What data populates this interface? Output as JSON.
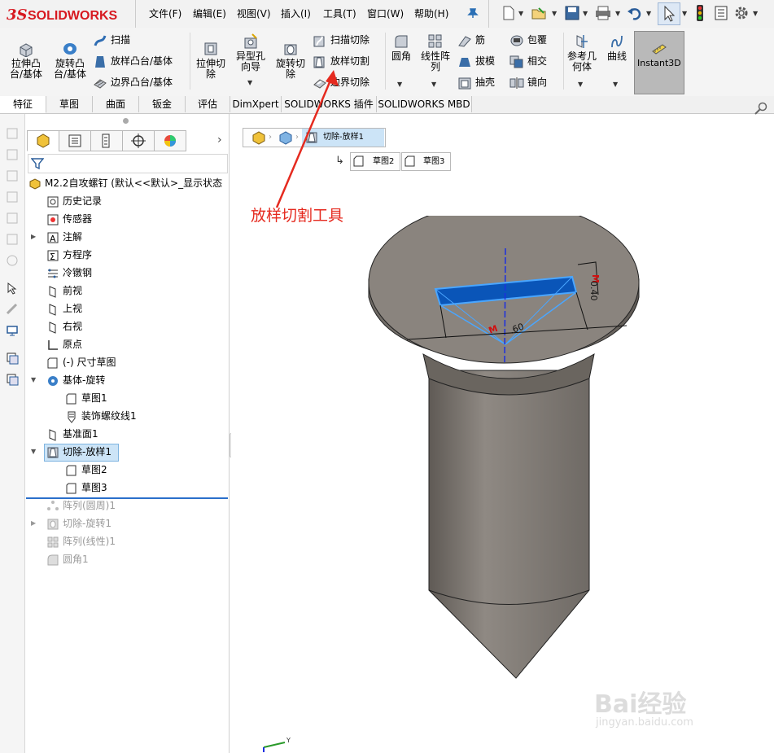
{
  "app": {
    "brand": "SOLIDWORKS",
    "brand_color": "#d71920"
  },
  "menu": [
    "文件(F)",
    "编辑(E)",
    "视图(V)",
    "插入(I)",
    "工具(T)",
    "窗口(W)",
    "帮助(H)"
  ],
  "ribbon": {
    "extrude_boss": "拉伸凸\n台/基体",
    "revolve_boss": "旋转凸\n台/基体",
    "sweep": "扫描",
    "loft_boss": "放样凸台/基体",
    "boundary_boss": "边界凸台/基体",
    "extrude_cut": "拉伸切\n除",
    "hole_wizard": "异型孔\n向导",
    "revolve_cut": "旋转切\n除",
    "sweep_cut": "扫描切除",
    "loft_cut": "放样切割",
    "boundary_cut": "边界切除",
    "fillet": "圆角",
    "linear_pattern": "线性阵\n列",
    "rib": "筋",
    "draft": "拔模",
    "shell": "抽壳",
    "wrap": "包覆",
    "intersect": "相交",
    "mirror": "镜向",
    "ref_geometry": "参考几\n何体",
    "curves": "曲线",
    "instant3d": "Instant3D"
  },
  "tabs": [
    "特征",
    "草图",
    "曲面",
    "钣金",
    "评估",
    "DimXpert",
    "SOLIDWORKS 插件",
    "SOLIDWORKS MBD"
  ],
  "tree": {
    "root": "M2.2自攻螺钉 (默认<<默认>_显示状态",
    "items": {
      "history": "历史记录",
      "sensors": "传感器",
      "annotations": "注解",
      "equations": "方程序",
      "material": "冷镦钢",
      "front": "前视",
      "top": "上视",
      "right": "右视",
      "origin": "原点",
      "dim_sketch": "(-) 尺寸草图",
      "base_revolve": "基体-旋转",
      "sketch1": "草图1",
      "cosmetic_thread": "装饰螺纹线1",
      "plane1": "基准面1",
      "cut_loft": "切除-放样1",
      "sketch2": "草图2",
      "sketch3": "草图3",
      "circ_pattern": "阵列(圆周)1",
      "cut_revolve": "切除-旋转1",
      "lin_pattern": "阵列(线性)1",
      "fillet1": "圆角1"
    }
  },
  "breadcrumb": {
    "feature": "切除-放样1",
    "sketch_a": "草图2",
    "sketch_b": "草图3"
  },
  "annotation": {
    "text": "放样切割工具",
    "color": "#e52a1f"
  },
  "model": {
    "dim_a": "0.40",
    "dim_b": ".60",
    "dim_m": "M"
  },
  "triad": {
    "y_label": "Y"
  },
  "watermark": {
    "brand": "Bai经验",
    "url": "jingyan.baidu.com"
  }
}
